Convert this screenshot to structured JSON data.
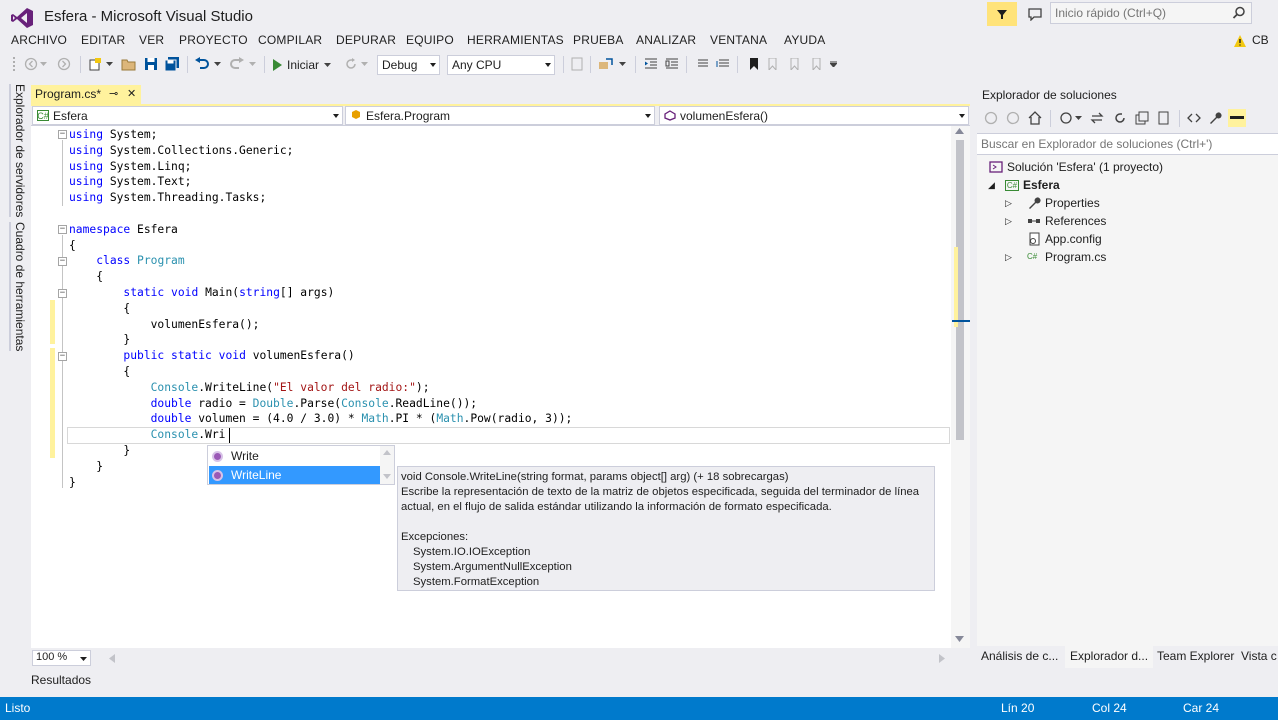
{
  "window": {
    "title": "Esfera - Microsoft Visual Studio"
  },
  "quick_launch": {
    "placeholder": "Inicio rápido (Ctrl+Q)"
  },
  "menu": [
    "ARCHIVO",
    "EDITAR",
    "VER",
    "PROYECTO",
    "COMPILAR",
    "DEPURAR",
    "EQUIPO",
    "HERRAMIENTAS",
    "PRUEBA",
    "ANALIZAR",
    "VENTANA",
    "AYUDA"
  ],
  "user": {
    "name": "CB"
  },
  "toolbar": {
    "start_label": "Iniciar",
    "config": "Debug",
    "platform": "Any CPU"
  },
  "left_strip": {
    "server_explorer": "Explorador de servidores",
    "toolbox": "Cuadro de herramientas"
  },
  "document": {
    "tab_label": "Program.cs*",
    "tab_pin": "⊸",
    "tab_close": "✕"
  },
  "navbar": {
    "project": "Esfera",
    "type": "Esfera.Program",
    "member": "volumenEsfera()"
  },
  "code": {
    "lines": [
      "using System;",
      "using System.Collections.Generic;",
      "using System.Linq;",
      "using System.Text;",
      "using System.Threading.Tasks;",
      "",
      "namespace Esfera",
      "{",
      "    class Program",
      "    {",
      "        static void Main(string[] args)",
      "        {",
      "            volumenEsfera();",
      "        }",
      "        public static void volumenEsfera()",
      "        {",
      "            Console.WriteLine(\"El valor del radio:\");",
      "            double radio = Double.Parse(Console.ReadLine());",
      "            double volumen = (4.0 / 3.0) * Math.PI * (Math.Pow(radio, 3));",
      "            Console.Wri",
      "        }",
      "    }",
      "}"
    ]
  },
  "editor": {
    "zoom": "100 %"
  },
  "completion": {
    "items": [
      "Write",
      "WriteLine"
    ],
    "selected": "WriteLine"
  },
  "tooltip": {
    "signature": "void Console.WriteLine(string format, params object[] arg)  (+ 18 sobrecargas)",
    "desc1": "Escribe la representación de texto de la matriz de objetos especificada, seguida del terminador de línea",
    "desc2": "actual, en el flujo de salida estándar utilizando la información de formato especificada.",
    "exceptions_title": "Excepciones:",
    "exceptions": [
      "System.IO.IOException",
      "System.ArgumentNullException",
      "System.FormatException"
    ]
  },
  "solution_explorer": {
    "title": "Explorador de soluciones",
    "search_placeholder": "Buscar en Explorador de soluciones (Ctrl+')",
    "tree": {
      "solution": "Solución 'Esfera'  (1 proyecto)",
      "project": "Esfera",
      "items": [
        "Properties",
        "References",
        "App.config",
        "Program.cs"
      ]
    },
    "tabs": [
      "Análisis de c...",
      "Explorador d...",
      "Team Explorer",
      "Vista c"
    ]
  },
  "output": {
    "title": "Resultados"
  },
  "status": {
    "state": "Listo",
    "line": "Lín 20",
    "col": "Col 24",
    "char": "Car 24"
  },
  "colors": {
    "accent": "#007acc",
    "vs_purple": "#68217a",
    "tab_active": "#fff29d",
    "selection": "#3399ff"
  }
}
